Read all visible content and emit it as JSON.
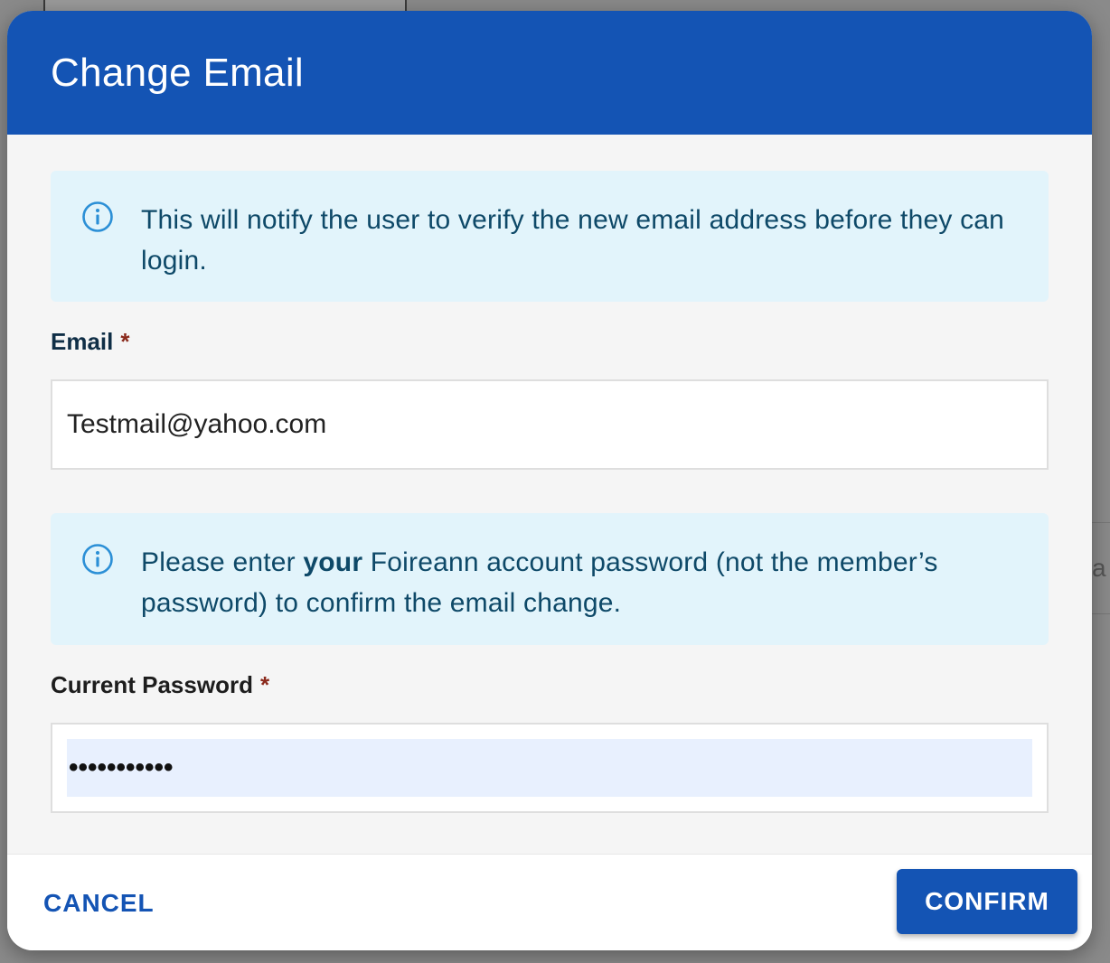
{
  "dialog": {
    "title": "Change Email",
    "header_color": "#1454b4"
  },
  "alerts": {
    "email_notice": {
      "icon": "info-icon",
      "text": "This will notify the user to verify the new email address before they can login."
    },
    "password_notice": {
      "icon": "info-icon",
      "text_before": "Please enter ",
      "text_bold": "your",
      "text_after": " Foireann account password (not the member’s password) to confirm the email change."
    }
  },
  "form": {
    "email": {
      "label": "Email",
      "required_mark": "*",
      "value": "Testmail@yahoo.com"
    },
    "current_password": {
      "label": "Current Password",
      "required_mark": "*",
      "masked_value": "•••••••••••"
    }
  },
  "footer": {
    "cancel_label": "CANCEL",
    "confirm_label": "CONFIRM"
  },
  "backdrop": {
    "right_edge_glyph": "a"
  }
}
